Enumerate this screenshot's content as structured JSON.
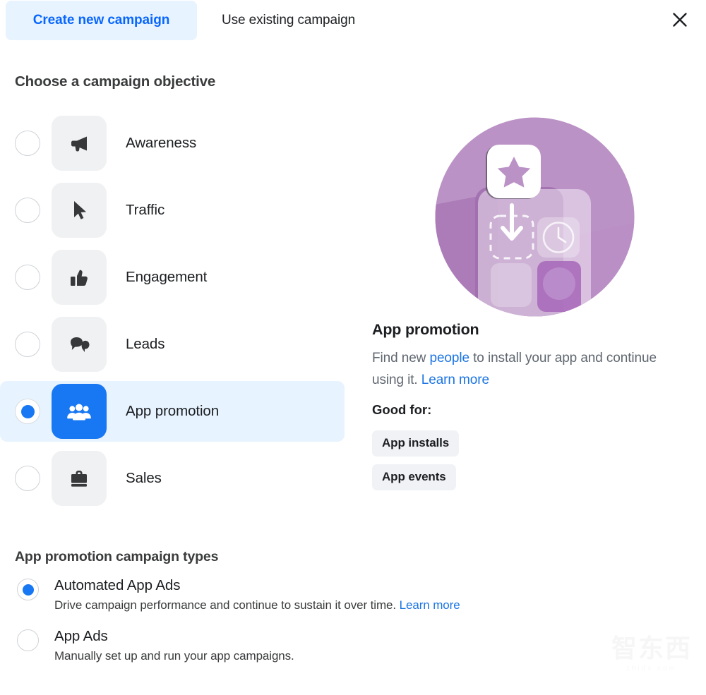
{
  "header": {
    "tab_active": "Create new campaign",
    "tab_inactive": "Use existing campaign",
    "close_icon": "close-icon",
    "accent_color": "#0866FF",
    "active_tab_bg": "#E7F3FF"
  },
  "objective_section": {
    "heading": "Choose a campaign objective",
    "options": [
      {
        "label": "Awareness",
        "icon": "megaphone-icon",
        "selected": false
      },
      {
        "label": "Traffic",
        "icon": "cursor-icon",
        "selected": false
      },
      {
        "label": "Engagement",
        "icon": "thumbs-up-icon",
        "selected": false
      },
      {
        "label": "Leads",
        "icon": "chat-bubbles-icon",
        "selected": false
      },
      {
        "label": "App promotion",
        "icon": "people-group-icon",
        "selected": true
      },
      {
        "label": "Sales",
        "icon": "briefcase-icon",
        "selected": false
      }
    ]
  },
  "detail": {
    "illustration": "app-promotion-illustration",
    "title": "App promotion",
    "description_part1": "Find new ",
    "description_link1": "people",
    "description_part2": " to install your app and continue using it. ",
    "description_link2": "Learn more",
    "good_for_label": "Good for:",
    "chips": [
      "App installs",
      "App events"
    ]
  },
  "types_section": {
    "heading": "App promotion campaign types",
    "options": [
      {
        "title": "Automated App Ads",
        "desc": "Drive campaign performance and continue to sustain it over time. ",
        "link": "Learn more",
        "selected": true
      },
      {
        "title": "App Ads",
        "desc": "Manually set up and run your app campaigns.",
        "link": "",
        "selected": false
      }
    ]
  },
  "watermark": {
    "text": "智东西",
    "sub": "zhidx.com"
  }
}
